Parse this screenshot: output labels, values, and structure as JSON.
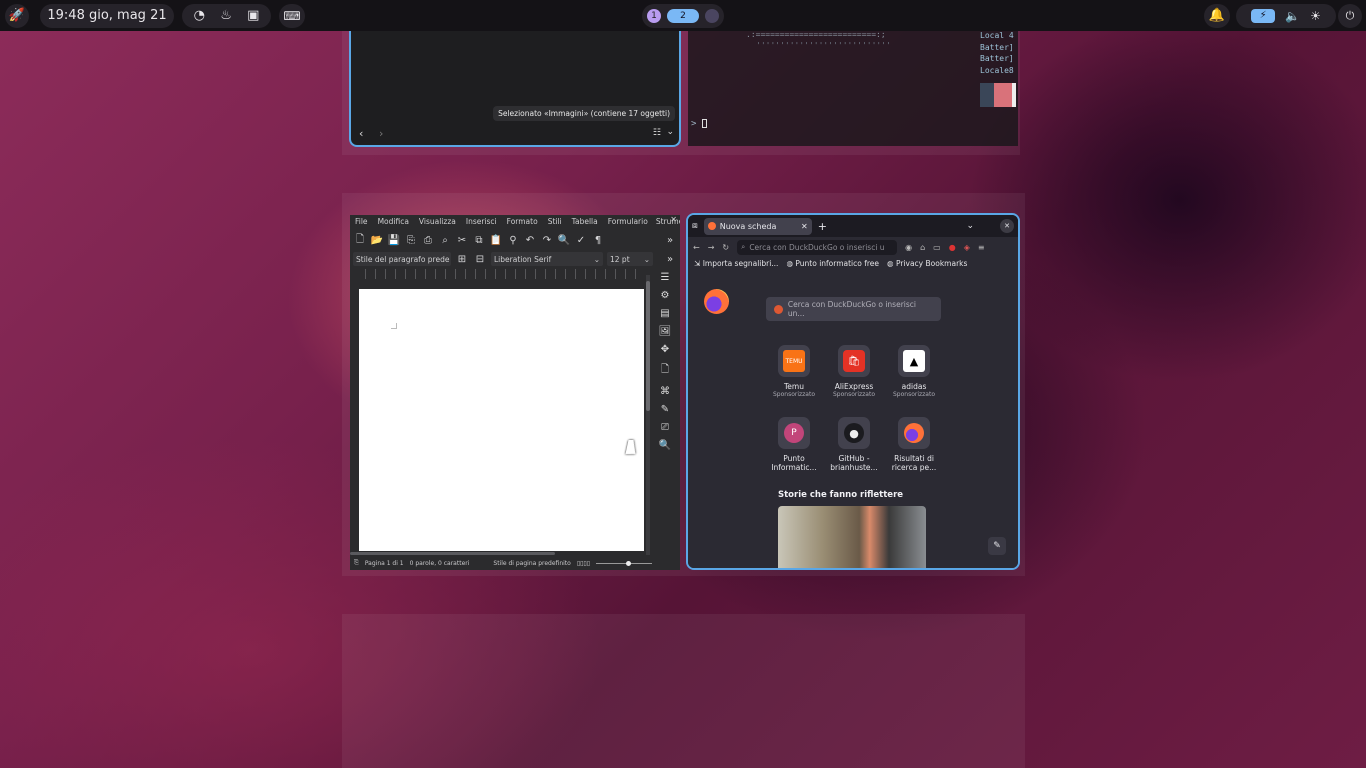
{
  "topbar": {
    "clock": "19:48 gio, mag 21",
    "workspaces": [
      "1",
      "2"
    ]
  },
  "files": {
    "status": "Selezionato «Immagini» (contiene 17 oggetti)"
  },
  "terminal": {
    "lines": [
      "Local 4",
      "Batter]",
      "Batter]",
      "Locale8"
    ],
    "art": ".:=========================:;",
    "art2": "''''''''''''''''''''''''''''",
    "prompt": ">"
  },
  "writer": {
    "menu": [
      "File",
      "Modifica",
      "Visualizza",
      "Inserisci",
      "Formato",
      "Stili",
      "Tabella",
      "Formulario",
      "Strumenti"
    ],
    "para_style": "Stile del paragrafo prede",
    "font": "Liberation Serif",
    "size": "12 pt",
    "status_page": "Pagina 1 di 1",
    "status_words": "0 parole, 0 caratteri",
    "status_style": "Stile di pagina predefinito"
  },
  "firefox": {
    "tab_title": "Nuova scheda",
    "urlbar_placeholder": "Cerca con DuckDuckGo o inserisci u",
    "bookmarks": [
      "Importa segnalibri...",
      "Punto informatico free",
      "Privacy Bookmarks"
    ],
    "search_placeholder": "Cerca con DuckDuckGo o inserisci un...",
    "shortcuts": [
      {
        "name": "Temu",
        "sub": "Sponsorizzato",
        "icon": "temu-icon"
      },
      {
        "name": "AliExpress",
        "sub": "Sponsorizzato",
        "icon": "aliexpress-icon"
      },
      {
        "name": "adidas",
        "sub": "Sponsorizzato",
        "icon": "adidas-icon"
      },
      {
        "name": "Punto Informatic...",
        "sub": "",
        "icon": "letter-p-icon"
      },
      {
        "name": "GitHub - brianhuste...",
        "sub": "",
        "icon": "github-icon"
      },
      {
        "name": "Risultati di ricerca pe...",
        "sub": "",
        "icon": "firefox-icon"
      }
    ],
    "stories_heading": "Storie che fanno riflettere"
  },
  "colors": {
    "accent": "#5aa7e6",
    "workspace_active": "#7ab8f5",
    "workspace_1": "#b99cf0"
  }
}
